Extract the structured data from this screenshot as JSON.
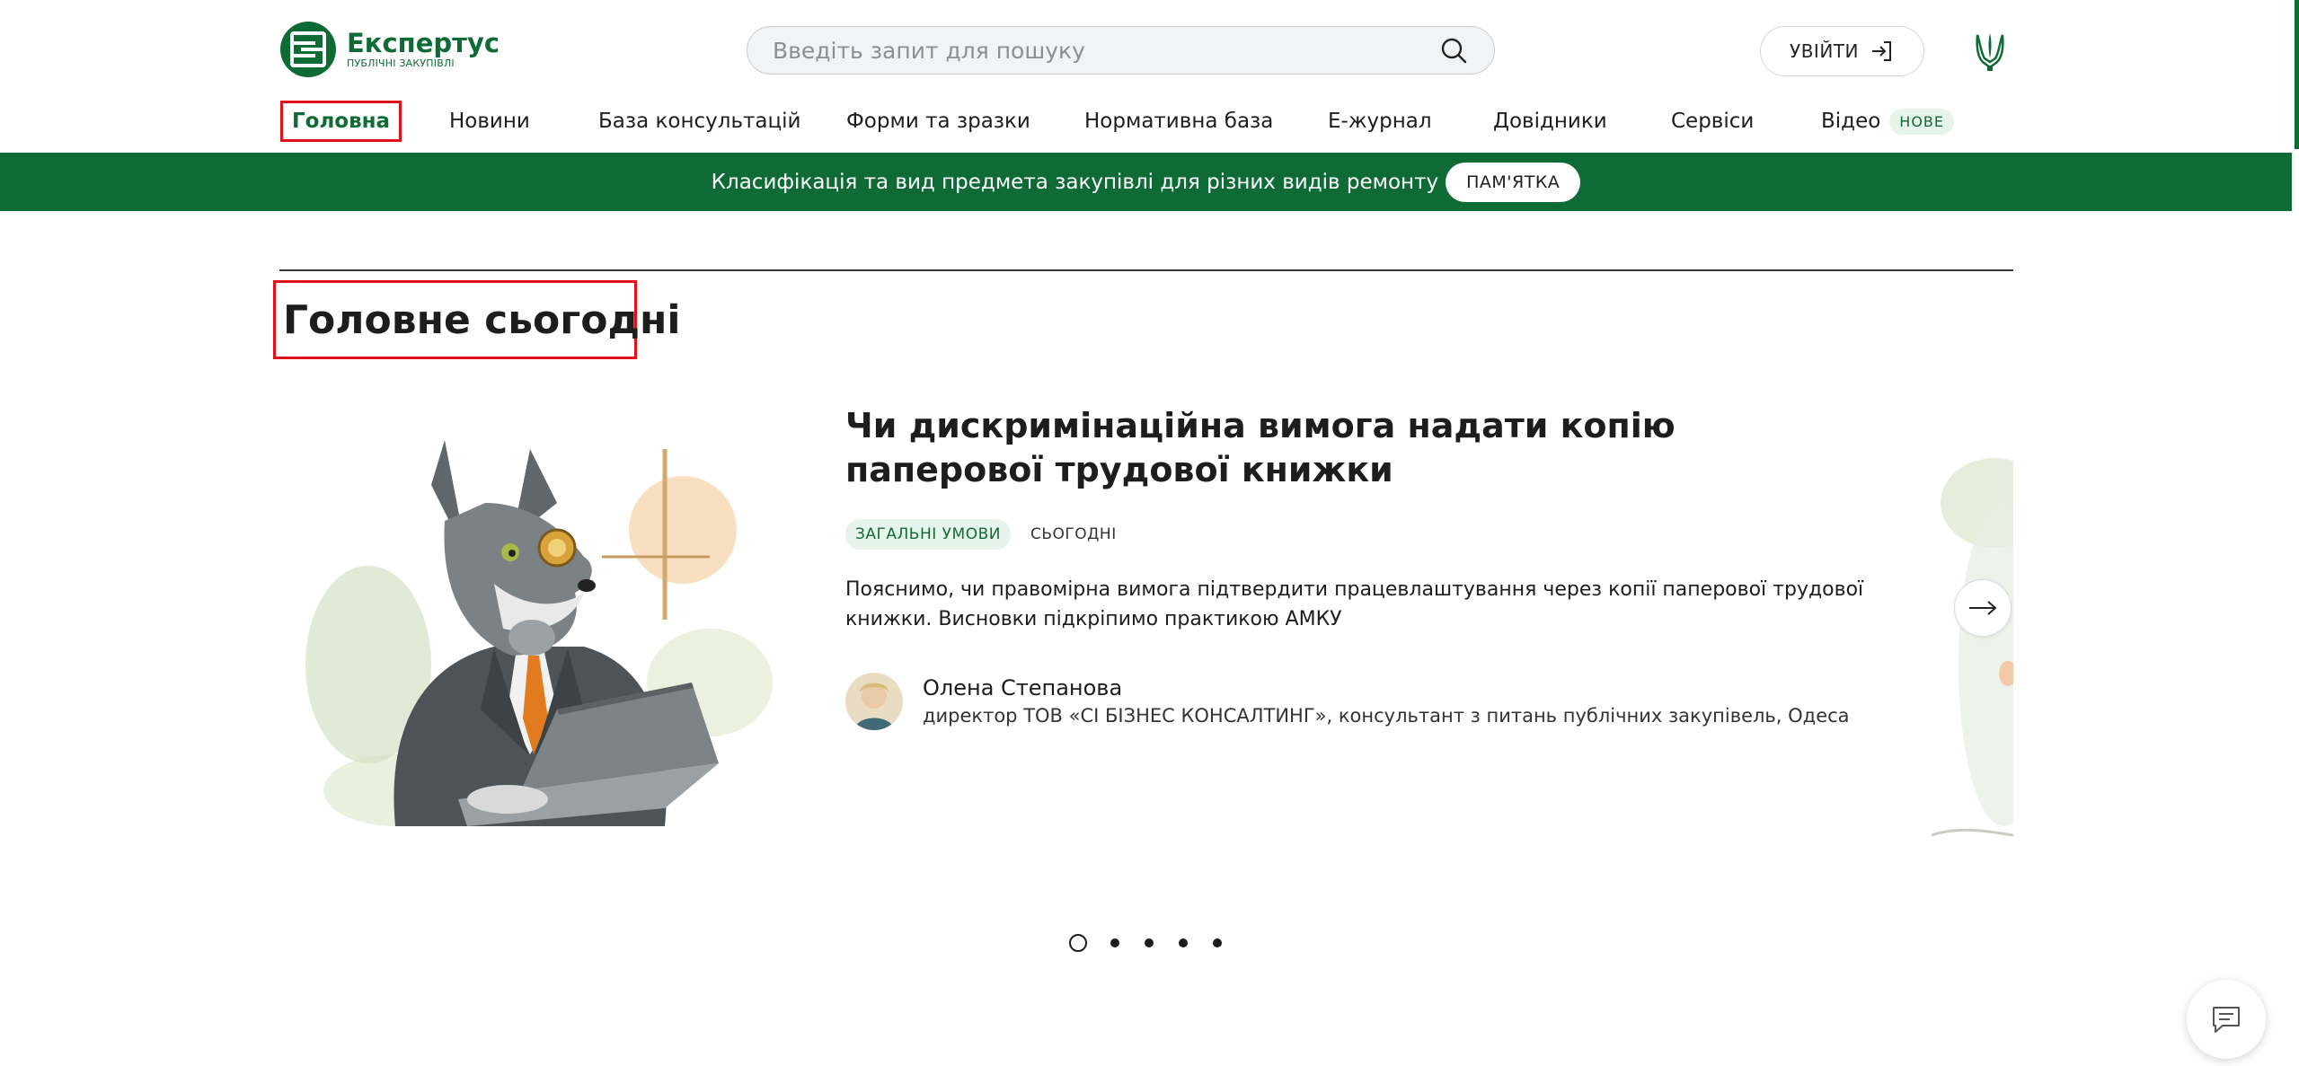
{
  "header": {
    "logo_name": "Експертус",
    "logo_sub": "ПУБЛІЧНІ ЗАКУПІВЛІ",
    "search_placeholder": "Введіть запит для пошуку",
    "login_label": "УВІЙТИ"
  },
  "nav": {
    "items": [
      {
        "label": "Головна",
        "active": true
      },
      {
        "label": "Новини"
      },
      {
        "label": "База консультацій"
      },
      {
        "label": "Форми та зразки"
      },
      {
        "label": "Нормативна база"
      },
      {
        "label": "Е-журнал"
      },
      {
        "label": "Довідники"
      },
      {
        "label": "Сервіси"
      },
      {
        "label": "Відео",
        "badge": "НОВЕ"
      }
    ]
  },
  "banner": {
    "text": "Класифікація та вид предмета закупівлі для різних видів ремонту",
    "button": "ПАМ'ЯТКА"
  },
  "section": {
    "title": "Головне сьогодні"
  },
  "article": {
    "title": "Чи дискримінаційна вимога надати копію паперової трудової книжки",
    "tag": "ЗАГАЛЬНІ УМОВИ",
    "date": "СЬОГОДНІ",
    "lead": "Пояснимо, чи правомірна вимога підтвердити працевлаштування через копії паперової трудової книжки. Висновки підкріпимо практикою АМКУ",
    "author_name": "Олена Степанова",
    "author_position": "директор ТОВ «СІ БІЗНЕС КОНСАЛТИНГ», консультант з питань публічних закупівель, Одеса"
  },
  "slider": {
    "slide_count": 5,
    "active_slide": 1
  },
  "colors": {
    "brand_green": "#0f6b35",
    "highlight_red": "#e3101b",
    "tag_bg": "#e7f4ec"
  },
  "icons": {
    "search": "search-icon",
    "login": "sign-in-icon",
    "coat_of_arms": "trident-icon",
    "next": "arrow-right-icon",
    "chat": "chat-icon"
  }
}
